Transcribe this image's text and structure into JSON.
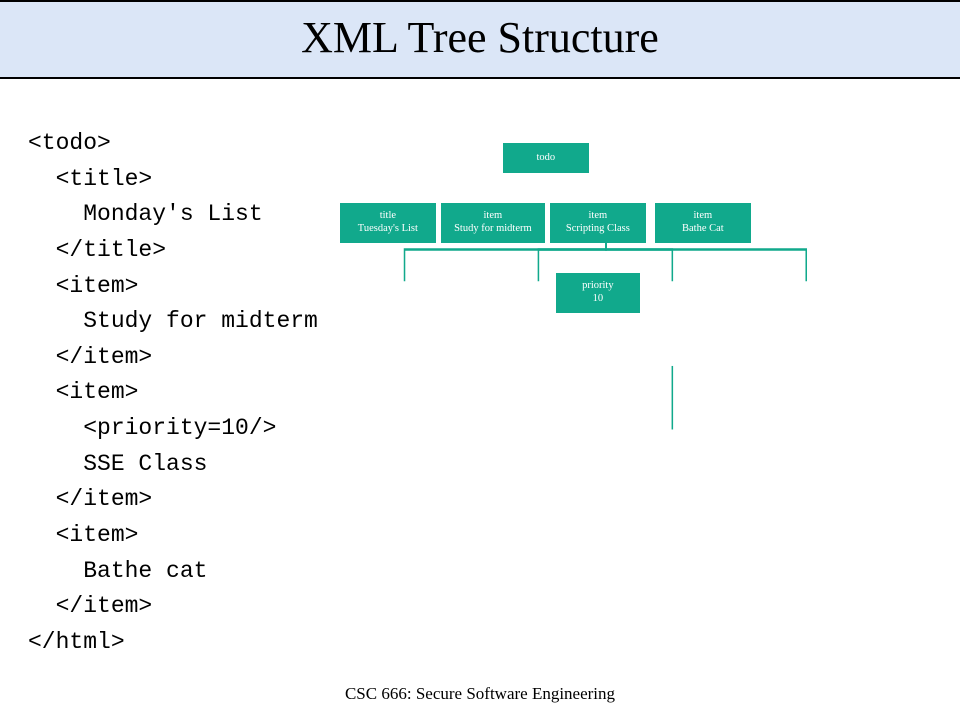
{
  "title": "XML Tree Structure",
  "code_lines": [
    "<todo>",
    "  <title>",
    "    Monday's List",
    "  </title>",
    "  <item>",
    "    Study for midterm",
    "  </item>",
    "  <item>",
    "    <priority=10/>",
    "    SSE Class",
    "  </item>",
    "  <item>",
    "    Bathe cat",
    "  </item>",
    "</html>"
  ],
  "tree": {
    "root": {
      "l1": "todo",
      "l2": ""
    },
    "n1": {
      "l1": "title",
      "l2": "Tuesday's List"
    },
    "n2": {
      "l1": "item",
      "l2": "Study for midterm"
    },
    "n3": {
      "l1": "item",
      "l2": "Scripting Class"
    },
    "n4": {
      "l1": "item",
      "l2": "Bathe Cat"
    },
    "n5": {
      "l1": "priority",
      "l2": "10"
    }
  },
  "footer": "CSC 666: Secure Software Engineering",
  "chart_data": {
    "type": "tree",
    "nodes": [
      {
        "id": "root",
        "label": "todo"
      },
      {
        "id": "n1",
        "label": "title — Tuesday's List",
        "parent": "root"
      },
      {
        "id": "n2",
        "label": "item — Study for midterm",
        "parent": "root"
      },
      {
        "id": "n3",
        "label": "item — Scripting Class",
        "parent": "root"
      },
      {
        "id": "n4",
        "label": "item — Bathe Cat",
        "parent": "root"
      },
      {
        "id": "n5",
        "label": "priority — 10",
        "parent": "n3"
      }
    ]
  }
}
